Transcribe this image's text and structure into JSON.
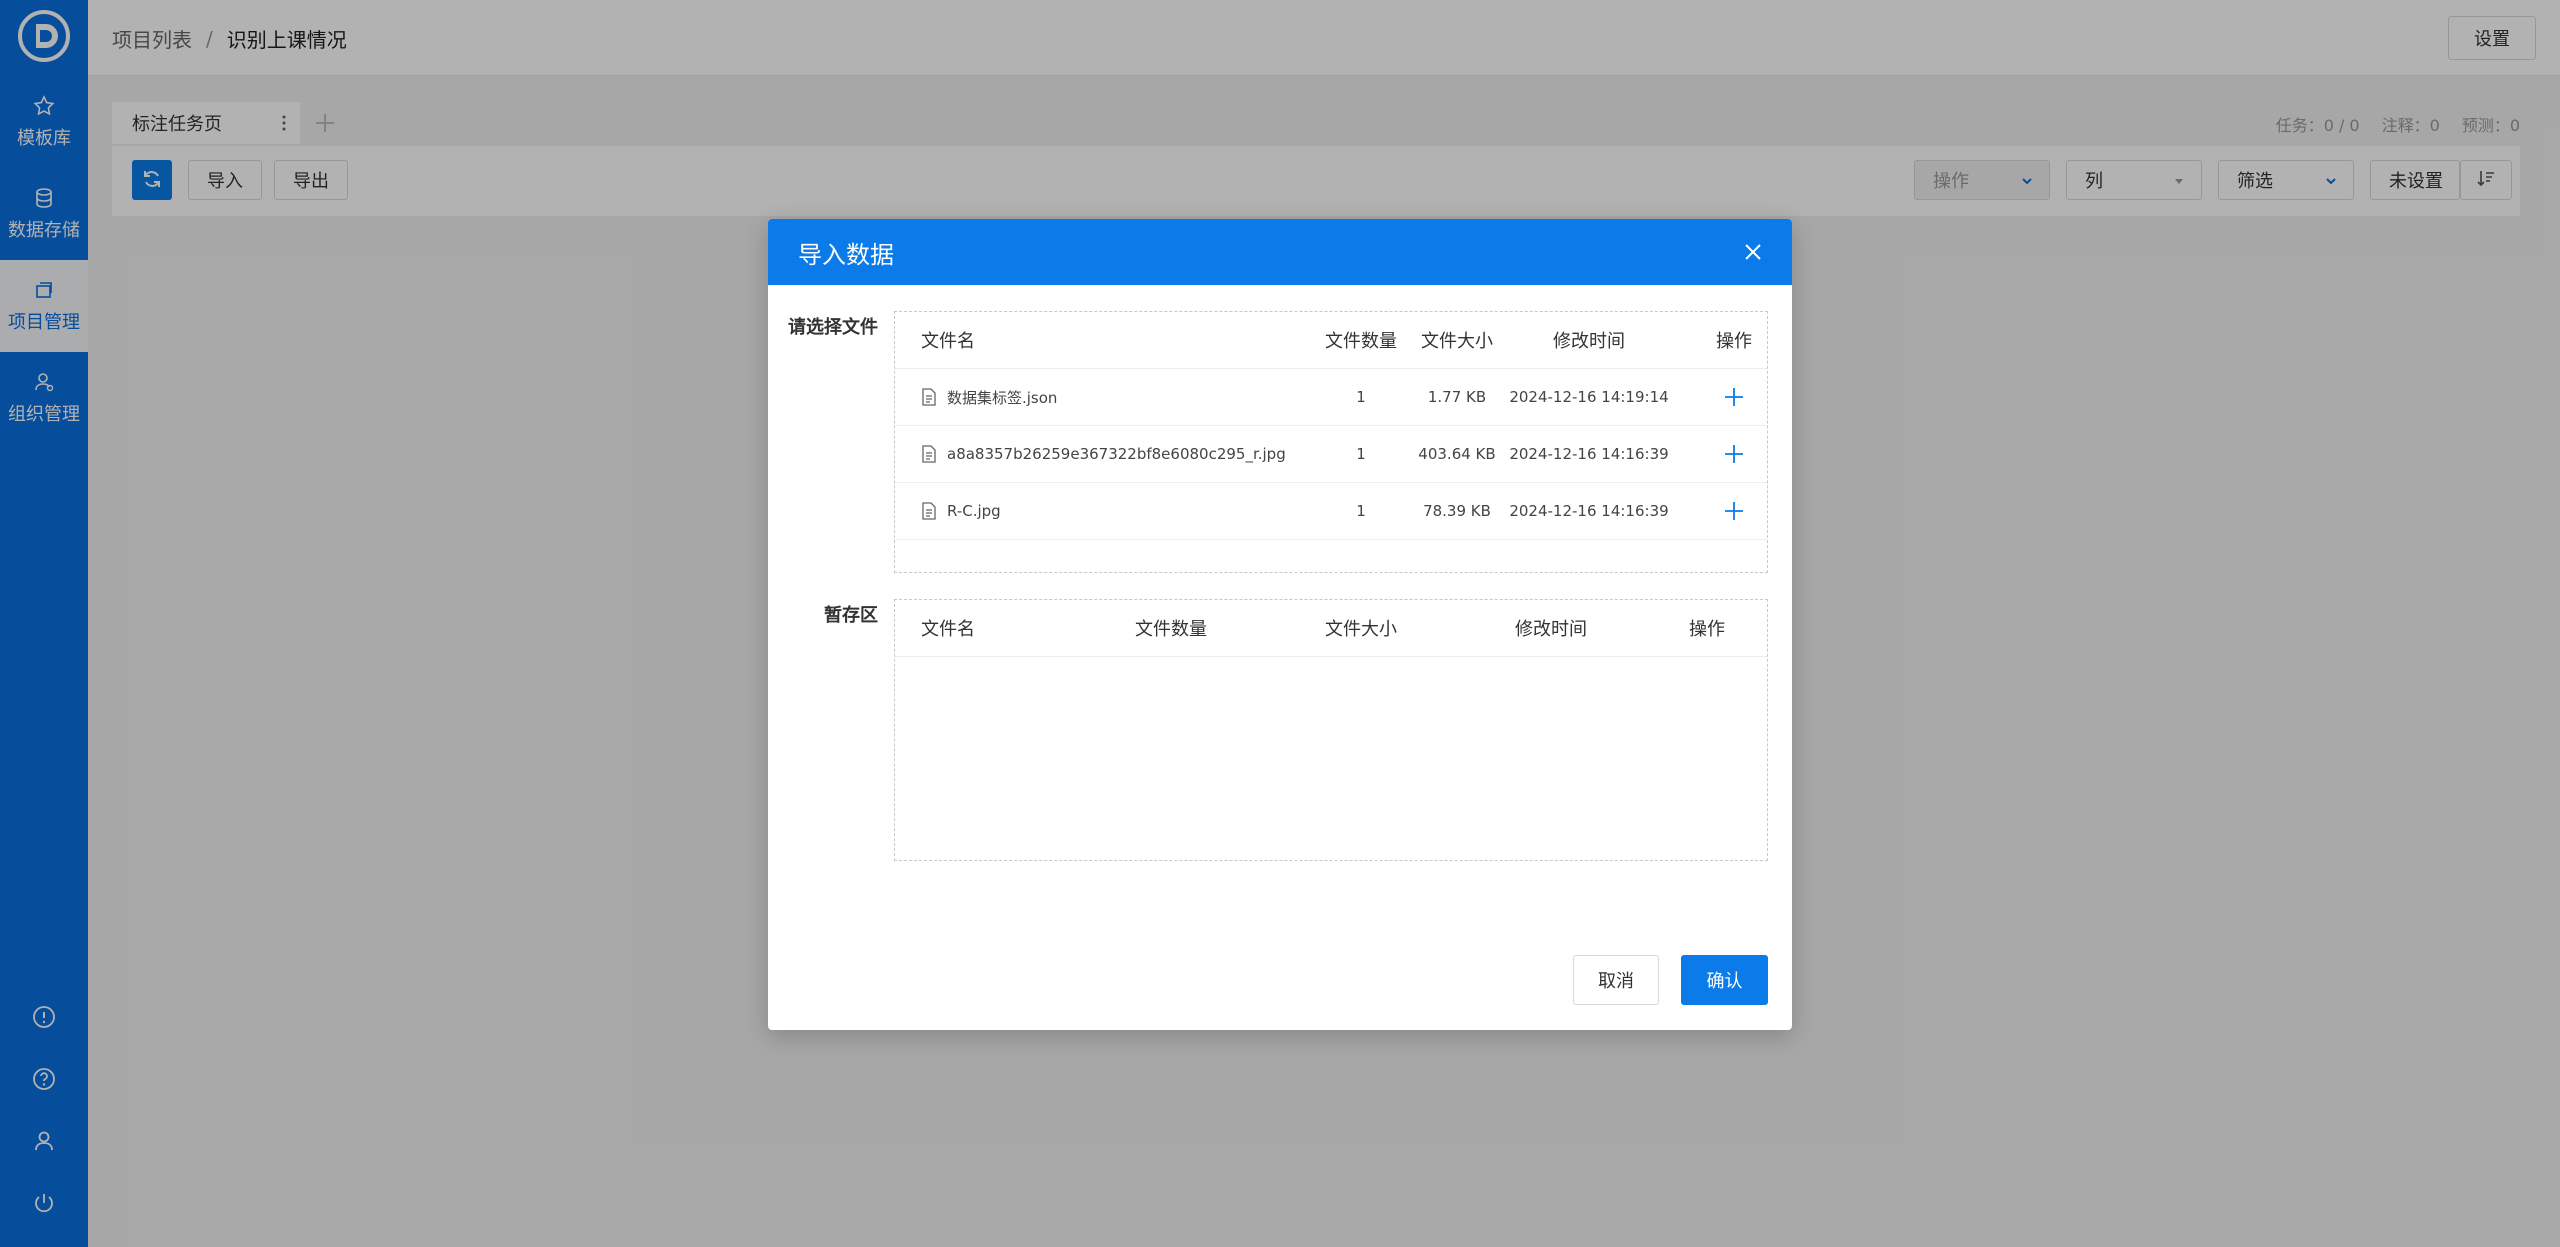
{
  "sidebar": {
    "items": [
      {
        "label": "模板库",
        "icon": "star-icon"
      },
      {
        "label": "数据存储",
        "icon": "database-icon"
      },
      {
        "label": "项目管理",
        "icon": "project-icon",
        "active": true
      },
      {
        "label": "组织管理",
        "icon": "user-group-icon"
      }
    ],
    "bottom_icons": [
      "info-icon",
      "help-icon",
      "user-icon",
      "power-icon"
    ]
  },
  "header": {
    "breadcrumb": [
      "项目列表",
      "识别上课情况"
    ],
    "separator": "/",
    "settings_label": "设置"
  },
  "tabs": {
    "items": [
      {
        "label": "标注任务页"
      }
    ],
    "stats": {
      "tasks": "任务：0 / 0",
      "annotations": "注释：0",
      "predictions": "预测：0"
    }
  },
  "toolbar": {
    "import_label": "导入",
    "export_label": "导出",
    "actions_label": "操作",
    "columns_label": "列",
    "filter_label": "筛选",
    "sort_label": "未设置"
  },
  "modal": {
    "title": "导入数据",
    "select_files_label": "请选择文件",
    "staging_label": "暂存区",
    "columns": {
      "name": "文件名",
      "count": "文件数量",
      "size": "文件大小",
      "modified": "修改时间",
      "action": "操作"
    },
    "files": [
      {
        "name": "数据集标签.json",
        "count": "1",
        "size": "1.77 KB",
        "modified": "2024-12-16 14:19:14"
      },
      {
        "name": "a8a8357b26259e367322bf8e6080c295_r.jpg",
        "count": "1",
        "size": "403.64 KB",
        "modified": "2024-12-16 14:16:39"
      },
      {
        "name": "R-C.jpg",
        "count": "1",
        "size": "78.39 KB",
        "modified": "2024-12-16 14:16:39"
      }
    ],
    "cancel_label": "取消",
    "confirm_label": "确认"
  },
  "colors": {
    "primary": "#0a7be8",
    "sidebar": "#0a6fe0"
  }
}
